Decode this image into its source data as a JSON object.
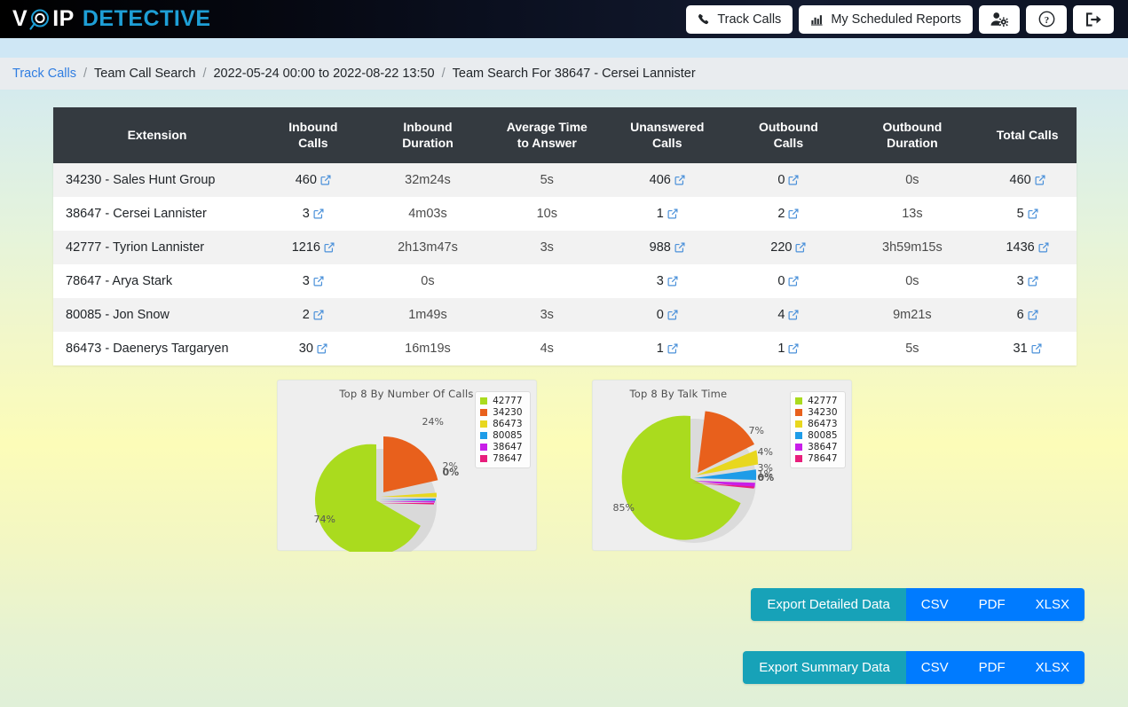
{
  "app": {
    "logo_prefix": "V",
    "logo_mid": "IP",
    "logo_suffix": "DETECTIVE",
    "logo_mark_icon": "magnifier-icon"
  },
  "nav": {
    "track_calls": "Track Calls",
    "scheduled_reports": "My Scheduled Reports",
    "track_calls_icon": "phone-icon",
    "scheduled_reports_icon": "bar-chart-icon",
    "user_settings_icon": "user-gear-icon",
    "help_icon": "question-circle-icon",
    "logout_icon": "sign-out-icon"
  },
  "breadcrumb": {
    "items": [
      {
        "label": "Track Calls",
        "link": true
      },
      {
        "label": "Team Call Search",
        "link": false
      },
      {
        "label": "2022-05-24 00:00 to 2022-08-22 13:50",
        "link": false
      },
      {
        "label": "Team Search For 38647 - Cersei Lannister",
        "link": false
      }
    ],
    "separator": "/"
  },
  "table": {
    "headers": [
      "Extension",
      "Inbound Calls",
      "Inbound Duration",
      "Average Time\nto Answer",
      "Unanswered Calls",
      "Outbound Calls",
      "Outbound Duration",
      "Total Calls"
    ],
    "header_avg_line1": "Average Time",
    "header_avg_line2": "to Answer",
    "link_icon": "external-link-icon",
    "rows": [
      {
        "extension": "34230 - Sales Hunt Group",
        "inbound_calls": "460",
        "inbound_duration": "32m24s",
        "avg_time_to_answer": "5s",
        "unanswered_calls": "406",
        "outbound_calls": "0",
        "outbound_duration": "0s",
        "total_calls": "460"
      },
      {
        "extension": "38647 - Cersei Lannister",
        "inbound_calls": "3",
        "inbound_duration": "4m03s",
        "avg_time_to_answer": "10s",
        "unanswered_calls": "1",
        "outbound_calls": "2",
        "outbound_duration": "13s",
        "total_calls": "5"
      },
      {
        "extension": "42777 - Tyrion Lannister",
        "inbound_calls": "1216",
        "inbound_duration": "2h13m47s",
        "avg_time_to_answer": "3s",
        "unanswered_calls": "988",
        "outbound_calls": "220",
        "outbound_duration": "3h59m15s",
        "total_calls": "1436"
      },
      {
        "extension": "78647 - Arya Stark",
        "inbound_calls": "3",
        "inbound_duration": "0s",
        "avg_time_to_answer": "",
        "unanswered_calls": "3",
        "outbound_calls": "0",
        "outbound_duration": "0s",
        "total_calls": "3"
      },
      {
        "extension": "80085 - Jon Snow",
        "inbound_calls": "2",
        "inbound_duration": "1m49s",
        "avg_time_to_answer": "3s",
        "unanswered_calls": "0",
        "outbound_calls": "4",
        "outbound_duration": "9m21s",
        "total_calls": "6"
      },
      {
        "extension": "86473 - Daenerys Targaryen",
        "inbound_calls": "30",
        "inbound_duration": "16m19s",
        "avg_time_to_answer": "4s",
        "unanswered_calls": "1",
        "outbound_calls": "1",
        "outbound_duration": "5s",
        "total_calls": "31"
      }
    ]
  },
  "chart_data": [
    {
      "type": "pie",
      "title": "Top 8 By Number Of Calls",
      "categories": [
        "42777",
        "34230",
        "86473",
        "80085",
        "38647",
        "78647"
      ],
      "values": [
        74,
        24,
        2,
        0,
        0,
        0
      ],
      "labels": [
        "74%",
        "24%",
        "2%",
        "0%",
        "0%",
        "0%"
      ],
      "colors": [
        "#aadb1e",
        "#e8601c",
        "#e8d71e",
        "#1e9ce8",
        "#c81ee8",
        "#e81e7c"
      ],
      "legend_position": "top-right",
      "exploded": true
    },
    {
      "type": "pie",
      "title": "Top 8 By Talk Time",
      "categories": [
        "42777",
        "34230",
        "86473",
        "80085",
        "38647",
        "78647"
      ],
      "values": [
        85,
        7,
        4,
        3,
        1,
        0
      ],
      "labels": [
        "85%",
        "7%",
        "4%",
        "3%",
        "1%",
        "0%"
      ],
      "colors": [
        "#aadb1e",
        "#e8601c",
        "#e8d71e",
        "#1e9ce8",
        "#c81ee8",
        "#e81e7c"
      ],
      "legend_position": "top-right",
      "exploded": true
    }
  ],
  "exports": [
    {
      "label": "Export Detailed Data",
      "options": [
        "CSV",
        "PDF",
        "XLSX"
      ]
    },
    {
      "label": "Export Summary Data",
      "options": [
        "CSV",
        "PDF",
        "XLSX"
      ]
    }
  ]
}
